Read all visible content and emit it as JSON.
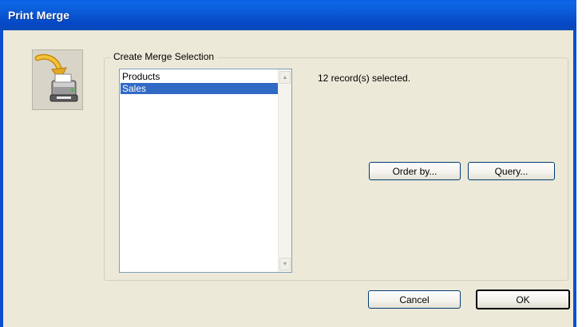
{
  "window": {
    "title": "Print Merge"
  },
  "group": {
    "label": "Create Merge Selection"
  },
  "list": {
    "items": [
      {
        "label": "Products",
        "selected": false
      },
      {
        "label": "Sales",
        "selected": true
      }
    ]
  },
  "status": {
    "text": "12 record(s) selected."
  },
  "buttons": {
    "order_by": "Order by...",
    "query": "Query...",
    "cancel": "Cancel",
    "ok": "OK"
  },
  "icons": {
    "dialog_icon": "print-merge-icon",
    "scroll_up": "scroll-up-arrow-icon",
    "scroll_down": "scroll-down-arrow-icon"
  },
  "colors": {
    "titlebar": "#0b5ad6",
    "selection": "#316ac5",
    "dialog_bg": "#ece9d8"
  }
}
